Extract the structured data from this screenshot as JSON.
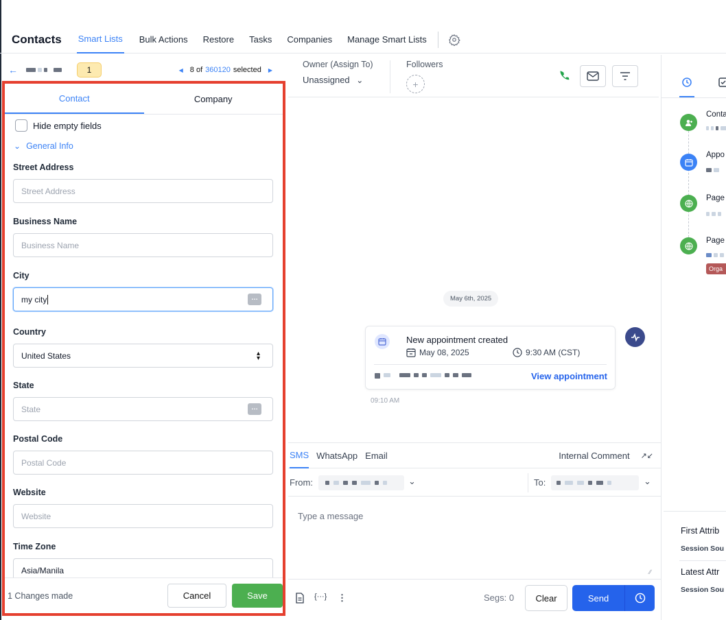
{
  "nav": {
    "title": "Contacts",
    "tabs": [
      "Smart Lists",
      "Bulk Actions",
      "Restore",
      "Tasks",
      "Companies",
      "Manage Smart Lists"
    ],
    "active_tab": "Smart Lists",
    "settings_icon": "gear-icon"
  },
  "record_nav": {
    "back_icon": "arrow-left-icon",
    "badge": "1",
    "pager_position": "8 of",
    "pager_total": "360120",
    "pager_suffix": "selected"
  },
  "details_panel": {
    "tabs": [
      "Contact",
      "Company"
    ],
    "active_tab": "Contact",
    "hide_empty_label": "Hide empty fields",
    "section_label": "General Info",
    "fields": [
      {
        "label": "Street Address",
        "placeholder": "Street Address",
        "value": ""
      },
      {
        "label": "Business Name",
        "placeholder": "Business Name",
        "value": ""
      },
      {
        "label": "City",
        "placeholder": "",
        "value": "my city"
      },
      {
        "label": "Country",
        "placeholder": "",
        "value": "United States"
      },
      {
        "label": "State",
        "placeholder": "State",
        "value": ""
      },
      {
        "label": "Postal Code",
        "placeholder": "Postal Code",
        "value": ""
      },
      {
        "label": "Website",
        "placeholder": "Website",
        "value": ""
      },
      {
        "label": "Time Zone",
        "placeholder": "",
        "value": "Asia/Manila"
      }
    ],
    "footer": {
      "changes_text": "1 Changes made",
      "cancel_label": "Cancel",
      "save_label": "Save"
    }
  },
  "conversation": {
    "owner_label": "Owner (Assign To)",
    "owner_value": "Unassigned",
    "followers_label": "Followers",
    "date_pill": "May 6th, 2025",
    "appointment": {
      "title": "New appointment created",
      "date": "May 08, 2025",
      "time": "9:30 AM (CST)",
      "view_label": "View appointment"
    },
    "timestamp": "09:10 AM",
    "composer": {
      "tabs": [
        "SMS",
        "WhatsApp",
        "Email"
      ],
      "active_tab": "SMS",
      "internal_comment": "Internal Comment",
      "from_label": "From:",
      "to_label": "To:",
      "message_placeholder": "Type a message",
      "segs": "Segs: 0",
      "clear_label": "Clear",
      "send_label": "Send"
    }
  },
  "activity_panel": {
    "items": [
      "Conta",
      "Appo",
      "Page",
      "Page"
    ],
    "tag": "Orga",
    "first_attribution": "First Attrib",
    "first_session": "Session Sou",
    "latest_attribution": "Latest Attr",
    "latest_session": "Session Sou"
  },
  "colors": {
    "accent": "#3b82f6",
    "highlight_outline": "#e5402f",
    "save_green": "#4caf50",
    "send_blue": "#2563eb"
  }
}
